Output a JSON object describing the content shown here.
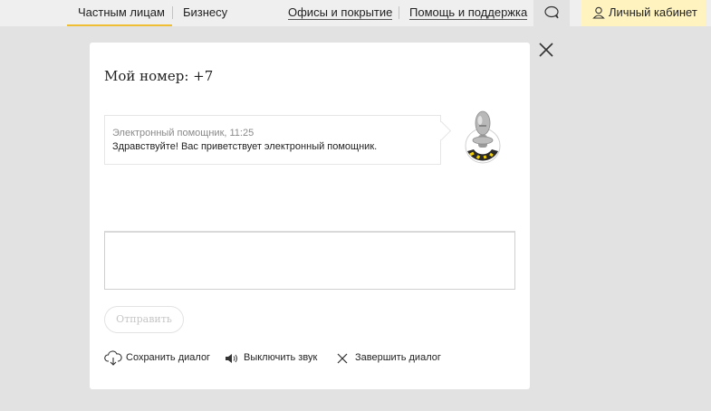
{
  "nav": {
    "private": "Частным лицам",
    "business": "Бизнесу",
    "offices": "Офисы и покрытие",
    "help": "Помощь и поддержка",
    "cabinet": "Личный кабинет"
  },
  "modal": {
    "title": "Мой номер: +7",
    "message": {
      "sender": "Электронный помощник, 11:25",
      "text": "Здравствуйте! Вас приветствует электронный помощник."
    },
    "input_value": "",
    "send_label": "Отправить",
    "actions": {
      "save": "Сохранить диалог",
      "mute": "Выключить звук",
      "end": "Завершить диалог"
    }
  },
  "colors": {
    "accent": "#f0be32",
    "cabinet_bg": "#fff3c0",
    "page_bg": "#e2e2e2"
  },
  "icons": [
    "chat-icon",
    "user-icon",
    "close-icon",
    "robot-avatar",
    "cloud-download-icon",
    "speaker-icon",
    "close-small-icon"
  ]
}
